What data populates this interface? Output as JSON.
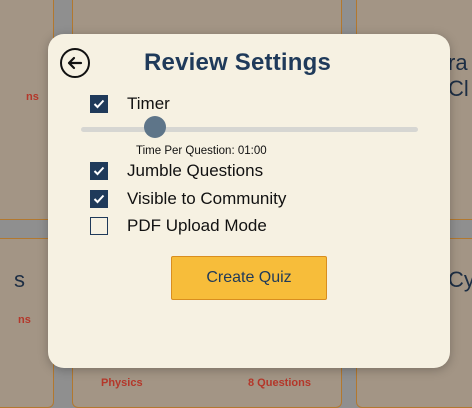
{
  "background": {
    "left_partial_text_1": "ns",
    "left_partial_text_2": "s",
    "left_partial_text_3": "ns",
    "right_partial_text_1": "ra",
    "right_partial_text_2": "Cl",
    "right_partial_text_3": "Cy",
    "bottom_subject": "Physics",
    "bottom_count": "8 Questions"
  },
  "modal": {
    "title": "Review Settings",
    "options": [
      {
        "label": "Timer",
        "checked": true
      },
      {
        "label": "Jumble Questions",
        "checked": true
      },
      {
        "label": "Visible to Community",
        "checked": true
      },
      {
        "label": "PDF Upload Mode",
        "checked": false
      }
    ],
    "timer_slider": {
      "caption": "Time Per Question: 01:00",
      "value_fraction": 0.22
    },
    "create_button_label": "Create Quiz"
  },
  "colors": {
    "primary": "#1f3a5a",
    "button": "#f7bd3a",
    "modal_bg": "#f6f1e2",
    "accent_red": "#b4372a"
  },
  "icons": {
    "back": "arrow-left-circle-icon",
    "check": "checkmark-icon"
  }
}
